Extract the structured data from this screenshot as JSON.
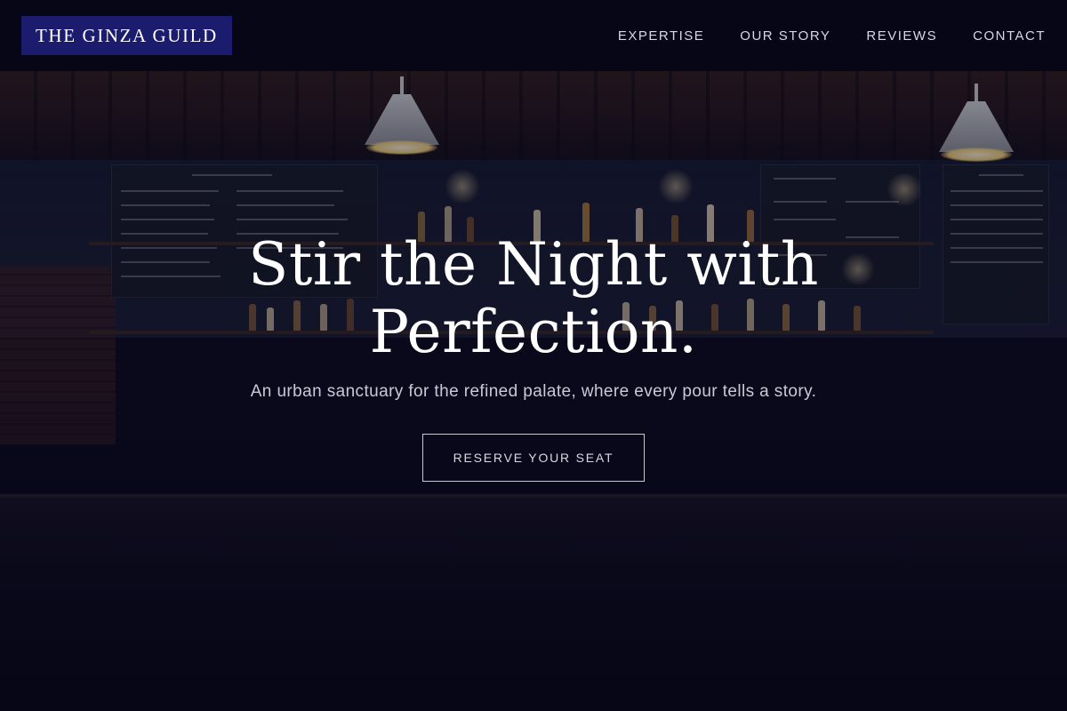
{
  "brand": {
    "logo_text": "THE GINZA GUILD",
    "accent": "#1c1c6e"
  },
  "nav": {
    "items": [
      {
        "label": "EXPERTISE"
      },
      {
        "label": "OUR STORY"
      },
      {
        "label": "REVIEWS"
      },
      {
        "label": "CONTACT"
      }
    ]
  },
  "hero": {
    "title_line1": "Stir the Night with",
    "title_line2": "Perfection.",
    "subtitle": "An urban sanctuary for the refined palate, where every pour tells a story.",
    "cta_label": "RESERVE YOUR SEAT"
  },
  "colors": {
    "background": "#06061a",
    "text": "#ffffff",
    "muted_text": "#c9c9d6"
  }
}
